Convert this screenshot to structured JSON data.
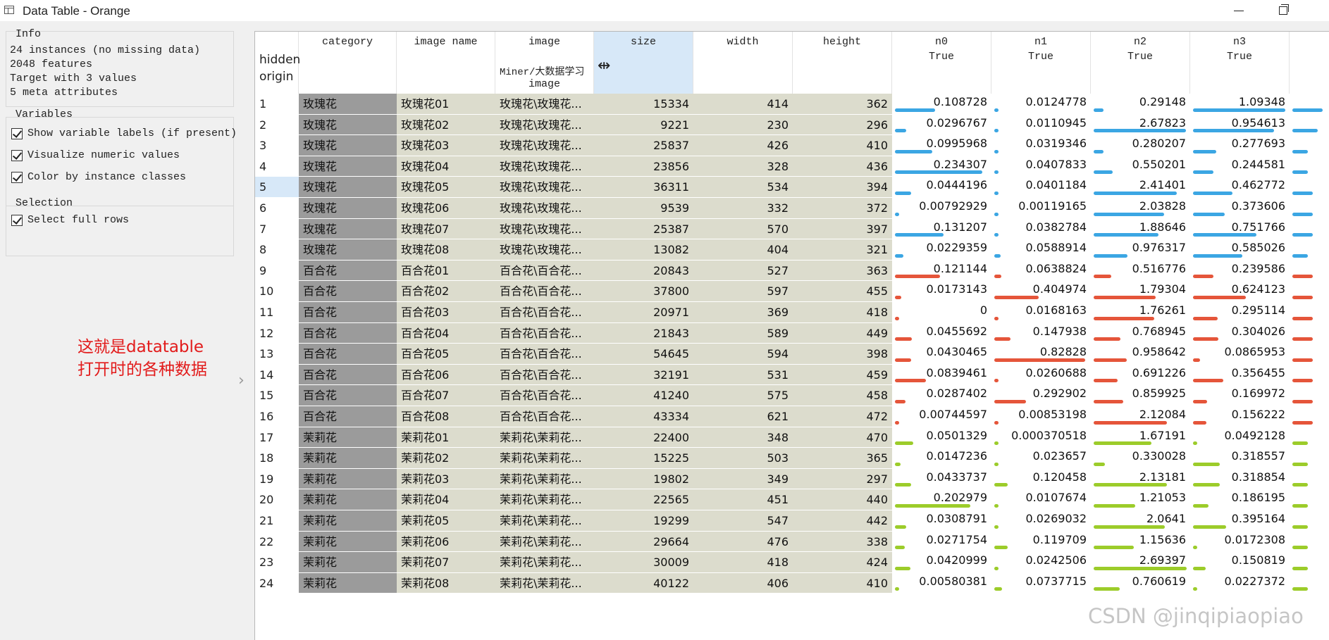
{
  "window": {
    "title": "Data Table - Orange"
  },
  "info": {
    "title": "Info",
    "lines": [
      "24 instances (no missing data)",
      "2048 features",
      "Target with 3 values",
      "5 meta attributes"
    ]
  },
  "variables": {
    "title": "Variables",
    "show_labels": "Show variable labels (if present)",
    "visualize": "Visualize numeric values",
    "color_by_class": "Color by instance classes"
  },
  "selection": {
    "title": "Selection",
    "select_full_rows": "Select full rows"
  },
  "annotation": {
    "line1": "这就是datatable",
    "line2": "打开时的各种数据"
  },
  "watermark": "CSDN @jinqipiaopiao",
  "colors": {
    "rose": "#3ba6e3",
    "lily": "#e5553a",
    "jasmine": "#9ccc2a",
    "selected": "#d7e8f8"
  },
  "table": {
    "vheader": [
      "hidden",
      "origin"
    ],
    "columns": {
      "category": "category",
      "image_name": "image name",
      "image": "image",
      "image_path": "Miner/大数据学习",
      "image_type": "image",
      "size": "size",
      "width": "width",
      "height": "height",
      "n0": "n0",
      "n1": "n1",
      "n2": "n2",
      "n3": "n3",
      "feature_sub": "True"
    },
    "rows": [
      {
        "idx": "1",
        "cat": "玫瑰花",
        "name": "玫瑰花01",
        "img": "玫瑰花\\玫瑰花...",
        "size": "15334",
        "width": "414",
        "height": "362",
        "n0": "0.108728",
        "n1": "0.0124778",
        "n2": "0.29148",
        "n3": "1.09348",
        "cls": "rose",
        "v": [
          0.108728,
          0.0124778,
          0.29148,
          1.09348,
          0.6
        ]
      },
      {
        "idx": "2",
        "cat": "玫瑰花",
        "name": "玫瑰花02",
        "img": "玫瑰花\\玫瑰花...",
        "size": "9221",
        "width": "230",
        "height": "296",
        "n0": "0.0296767",
        "n1": "0.0110945",
        "n2": "2.67823",
        "n3": "0.954613",
        "cls": "rose",
        "v": [
          0.0296767,
          0.0110945,
          2.67823,
          0.954613,
          0.5
        ]
      },
      {
        "idx": "3",
        "cat": "玫瑰花",
        "name": "玫瑰花03",
        "img": "玫瑰花\\玫瑰花...",
        "size": "25837",
        "width": "426",
        "height": "410",
        "n0": "0.0995968",
        "n1": "0.0319346",
        "n2": "0.280207",
        "n3": "0.277693",
        "cls": "rose",
        "v": [
          0.0995968,
          0.0319346,
          0.280207,
          0.277693,
          0.3
        ]
      },
      {
        "idx": "4",
        "cat": "玫瑰花",
        "name": "玫瑰花04",
        "img": "玫瑰花\\玫瑰花...",
        "size": "23856",
        "width": "328",
        "height": "436",
        "n0": "0.234307",
        "n1": "0.0407833",
        "n2": "0.550201",
        "n3": "0.244581",
        "cls": "rose",
        "v": [
          0.234307,
          0.0407833,
          0.550201,
          0.244581,
          0.3
        ]
      },
      {
        "idx": "5",
        "cat": "玫瑰花",
        "name": "玫瑰花05",
        "img": "玫瑰花\\玫瑰花...",
        "size": "36311",
        "width": "534",
        "height": "394",
        "n0": "0.0444196",
        "n1": "0.0401184",
        "n2": "2.41401",
        "n3": "0.462772",
        "cls": "rose",
        "v": [
          0.0444196,
          0.0401184,
          2.41401,
          0.462772,
          0.4
        ]
      },
      {
        "idx": "6",
        "cat": "玫瑰花",
        "name": "玫瑰花06",
        "img": "玫瑰花\\玫瑰花...",
        "size": "9539",
        "width": "332",
        "height": "372",
        "n0": "0.00792929",
        "n1": "0.00119165",
        "n2": "2.03828",
        "n3": "0.373606",
        "cls": "rose",
        "v": [
          0.00792929,
          0.00119165,
          2.03828,
          0.373606,
          0.4
        ]
      },
      {
        "idx": "7",
        "cat": "玫瑰花",
        "name": "玫瑰花07",
        "img": "玫瑰花\\玫瑰花...",
        "size": "25387",
        "width": "570",
        "height": "397",
        "n0": "0.131207",
        "n1": "0.0382784",
        "n2": "1.88646",
        "n3": "0.751766",
        "cls": "rose",
        "v": [
          0.131207,
          0.0382784,
          1.88646,
          0.751766,
          0.4
        ]
      },
      {
        "idx": "8",
        "cat": "玫瑰花",
        "name": "玫瑰花08",
        "img": "玫瑰花\\玫瑰花...",
        "size": "13082",
        "width": "404",
        "height": "321",
        "n0": "0.0229359",
        "n1": "0.0588914",
        "n2": "0.976317",
        "n3": "0.585026",
        "cls": "rose",
        "v": [
          0.0229359,
          0.0588914,
          0.976317,
          0.585026,
          0.3
        ]
      },
      {
        "idx": "9",
        "cat": "百合花",
        "name": "百合花01",
        "img": "百合花\\百合花...",
        "size": "20843",
        "width": "527",
        "height": "363",
        "n0": "0.121144",
        "n1": "0.0638824",
        "n2": "0.516776",
        "n3": "0.239586",
        "cls": "lily",
        "v": [
          0.121144,
          0.0638824,
          0.516776,
          0.239586,
          0.4
        ]
      },
      {
        "idx": "10",
        "cat": "百合花",
        "name": "百合花02",
        "img": "百合花\\百合花...",
        "size": "37800",
        "width": "597",
        "height": "455",
        "n0": "0.0173143",
        "n1": "0.404974",
        "n2": "1.79304",
        "n3": "0.624123",
        "cls": "lily",
        "v": [
          0.0173143,
          0.404974,
          1.79304,
          0.624123,
          0.4
        ]
      },
      {
        "idx": "11",
        "cat": "百合花",
        "name": "百合花03",
        "img": "百合花\\百合花...",
        "size": "20971",
        "width": "369",
        "height": "418",
        "n0": "0",
        "n1": "0.0168163",
        "n2": "1.76261",
        "n3": "0.295114",
        "cls": "lily",
        "v": [
          0,
          0.0168163,
          1.76261,
          0.295114,
          0.4
        ]
      },
      {
        "idx": "12",
        "cat": "百合花",
        "name": "百合花04",
        "img": "百合花\\百合花...",
        "size": "21843",
        "width": "589",
        "height": "449",
        "n0": "0.0455692",
        "n1": "0.147938",
        "n2": "0.768945",
        "n3": "0.304026",
        "cls": "lily",
        "v": [
          0.0455692,
          0.147938,
          0.768945,
          0.304026,
          0.4
        ]
      },
      {
        "idx": "13",
        "cat": "百合花",
        "name": "百合花05",
        "img": "百合花\\百合花...",
        "size": "54645",
        "width": "594",
        "height": "398",
        "n0": "0.0430465",
        "n1": "0.82828",
        "n2": "0.958642",
        "n3": "0.0865953",
        "cls": "lily",
        "v": [
          0.0430465,
          0.82828,
          0.958642,
          0.0865953,
          0.4
        ]
      },
      {
        "idx": "14",
        "cat": "百合花",
        "name": "百合花06",
        "img": "百合花\\百合花...",
        "size": "32191",
        "width": "531",
        "height": "459",
        "n0": "0.0839461",
        "n1": "0.0260688",
        "n2": "0.691226",
        "n3": "0.356455",
        "cls": "lily",
        "v": [
          0.0839461,
          0.0260688,
          0.691226,
          0.356455,
          0.4
        ]
      },
      {
        "idx": "15",
        "cat": "百合花",
        "name": "百合花07",
        "img": "百合花\\百合花...",
        "size": "41240",
        "width": "575",
        "height": "458",
        "n0": "0.0287402",
        "n1": "0.292902",
        "n2": "0.859925",
        "n3": "0.169972",
        "cls": "lily",
        "v": [
          0.0287402,
          0.292902,
          0.859925,
          0.169972,
          0.4
        ]
      },
      {
        "idx": "16",
        "cat": "百合花",
        "name": "百合花08",
        "img": "百合花\\百合花...",
        "size": "43334",
        "width": "621",
        "height": "472",
        "n0": "0.00744597",
        "n1": "0.00853198",
        "n2": "2.12084",
        "n3": "0.156222",
        "cls": "lily",
        "v": [
          0.00744597,
          0.00853198,
          2.12084,
          0.156222,
          0.4
        ]
      },
      {
        "idx": "17",
        "cat": "茉莉花",
        "name": "茉莉花01",
        "img": "茉莉花\\茉莉花...",
        "size": "22400",
        "width": "348",
        "height": "470",
        "n0": "0.0501329",
        "n1": "0.000370518",
        "n2": "1.67191",
        "n3": "0.0492128",
        "cls": "jasmine",
        "v": [
          0.0501329,
          0.000370518,
          1.67191,
          0.0492128,
          0.3
        ]
      },
      {
        "idx": "18",
        "cat": "茉莉花",
        "name": "茉莉花02",
        "img": "茉莉花\\茉莉花...",
        "size": "15225",
        "width": "503",
        "height": "365",
        "n0": "0.0147236",
        "n1": "0.023657",
        "n2": "0.330028",
        "n3": "0.318557",
        "cls": "jasmine",
        "v": [
          0.0147236,
          0.023657,
          0.330028,
          0.318557,
          0.3
        ]
      },
      {
        "idx": "19",
        "cat": "茉莉花",
        "name": "茉莉花03",
        "img": "茉莉花\\茉莉花...",
        "size": "19802",
        "width": "349",
        "height": "297",
        "n0": "0.0433737",
        "n1": "0.120458",
        "n2": "2.13181",
        "n3": "0.318854",
        "cls": "jasmine",
        "v": [
          0.0433737,
          0.120458,
          2.13181,
          0.318854,
          0.3
        ]
      },
      {
        "idx": "20",
        "cat": "茉莉花",
        "name": "茉莉花04",
        "img": "茉莉花\\茉莉花...",
        "size": "22565",
        "width": "451",
        "height": "440",
        "n0": "0.202979",
        "n1": "0.0107674",
        "n2": "1.21053",
        "n3": "0.186195",
        "cls": "jasmine",
        "v": [
          0.202979,
          0.0107674,
          1.21053,
          0.186195,
          0.3
        ]
      },
      {
        "idx": "21",
        "cat": "茉莉花",
        "name": "茉莉花05",
        "img": "茉莉花\\茉莉花...",
        "size": "19299",
        "width": "547",
        "height": "442",
        "n0": "0.0308791",
        "n1": "0.0269032",
        "n2": "2.0641",
        "n3": "0.395164",
        "cls": "jasmine",
        "v": [
          0.0308791,
          0.0269032,
          2.0641,
          0.395164,
          0.3
        ]
      },
      {
        "idx": "22",
        "cat": "茉莉花",
        "name": "茉莉花06",
        "img": "茉莉花\\茉莉花...",
        "size": "29664",
        "width": "476",
        "height": "338",
        "n0": "0.0271754",
        "n1": "0.119709",
        "n2": "1.15636",
        "n3": "0.0172308",
        "cls": "jasmine",
        "v": [
          0.0271754,
          0.119709,
          1.15636,
          0.0172308,
          0.3
        ]
      },
      {
        "idx": "23",
        "cat": "茉莉花",
        "name": "茉莉花07",
        "img": "茉莉花\\茉莉花...",
        "size": "30009",
        "width": "418",
        "height": "424",
        "n0": "0.0420999",
        "n1": "0.0242506",
        "n2": "2.69397",
        "n3": "0.150819",
        "cls": "jasmine",
        "v": [
          0.0420999,
          0.0242506,
          2.69397,
          0.150819,
          0.3
        ]
      },
      {
        "idx": "24",
        "cat": "茉莉花",
        "name": "茉莉花08",
        "img": "茉莉花\\茉莉花...",
        "size": "40122",
        "width": "406",
        "height": "410",
        "n0": "0.00580381",
        "n1": "0.0737715",
        "n2": "0.760619",
        "n3": "0.0227372",
        "cls": "jasmine",
        "v": [
          0.00580381,
          0.0737715,
          0.760619,
          0.0227372,
          0.3
        ]
      }
    ],
    "feature_max": [
      0.25,
      0.85,
      2.7,
      1.1,
      1.0
    ]
  }
}
